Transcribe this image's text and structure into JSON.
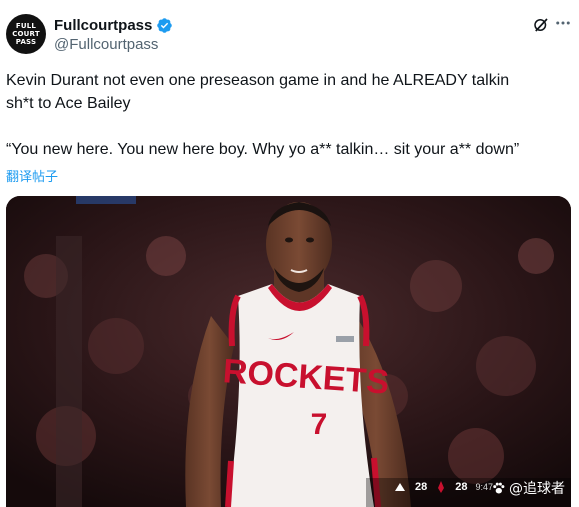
{
  "author": {
    "display_name": "Fullcourtpass",
    "handle": "@Fullcourtpass",
    "avatar_lines": [
      "FULL",
      "COURT",
      "PASS"
    ],
    "verified": true
  },
  "tweet": {
    "line1": "Kevin Durant not even one preseason game in and he ALREADY talkin",
    "line2": "sh*t to Ace Bailey",
    "quote": "“You new here. You new here boy. Why yo a** talkin… sit your a** down”",
    "translate_label": "翻译帖子"
  },
  "media": {
    "jersey_text": "ROCKETS",
    "jersey_number": "7",
    "scoreboard": {
      "team1_score": "28",
      "team2_score": "28",
      "clock": "9:47"
    },
    "watermark": "@追球者"
  },
  "colors": {
    "accent": "#1d9bf0",
    "text": "#0f1419",
    "secondary": "#536471",
    "rockets_red": "#c8102e"
  },
  "icons": [
    "verified-badge-icon",
    "grok-icon",
    "more-icon",
    "paw-icon",
    "jazz-logo-icon",
    "rockets-logo-icon"
  ]
}
